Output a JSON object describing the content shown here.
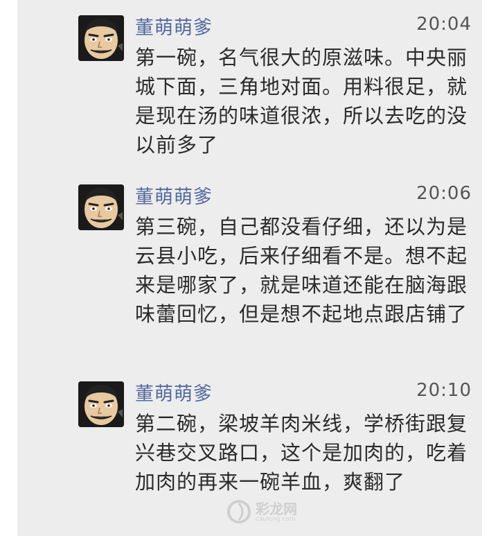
{
  "messages": [
    {
      "sender": "董萌萌爹",
      "time": "20:04",
      "text": "第一碗，名气很大的原滋味。中央丽城下面，三角地对面。用料很足，就是现在汤的味道很浓，所以去吃的没以前多了"
    },
    {
      "sender": "董萌萌爹",
      "time": "20:06",
      "text": "第三碗，自己都没看仔细，还以为是云县小吃，后来仔细看不是。想不起来是哪家了，就是味道还能在脑海跟味蕾回忆，但是想不起地点跟店铺了"
    },
    {
      "sender": "董萌萌爹",
      "time": "20:10",
      "text": "第二碗，梁坡羊肉米线，学桥街跟复兴巷交叉路口，这个是加肉的，吃着加肉的再来一碗羊血，爽翻了"
    }
  ],
  "watermark": {
    "text": "彩龙网",
    "sub": "caulong.com"
  },
  "colors": {
    "panel_bg": "#ededed",
    "sender_name": "#536a9e",
    "message_text": "#2b2b2b",
    "timestamp": "#555555"
  },
  "icons": {
    "avatar": "cartoon-face-avatar-icon"
  }
}
